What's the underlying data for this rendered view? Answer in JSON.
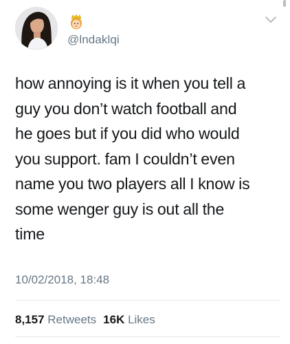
{
  "user": {
    "handle": "@lndaklqi",
    "avatar": "profile-photo",
    "badge_icon": "princess-emoji-icon"
  },
  "tweet": {
    "lines": [
      "how annoying is it when you tell a",
      "guy you don’t watch football and",
      "he goes but if you did who would",
      "you support. fam I couldn’t even",
      "name you two players all I know is",
      "some wenger guy is out all the",
      "time"
    ],
    "timestamp": "10/02/2018, 18:48"
  },
  "stats": {
    "retweets_count": "8,157",
    "retweets_label": "Retweets",
    "likes_count": "16K",
    "likes_label": "Likes"
  },
  "menu_icon": "chevron-down-icon",
  "colors": {
    "text": "#14171a",
    "secondary": "#657786",
    "divider": "#e1e8ed"
  }
}
